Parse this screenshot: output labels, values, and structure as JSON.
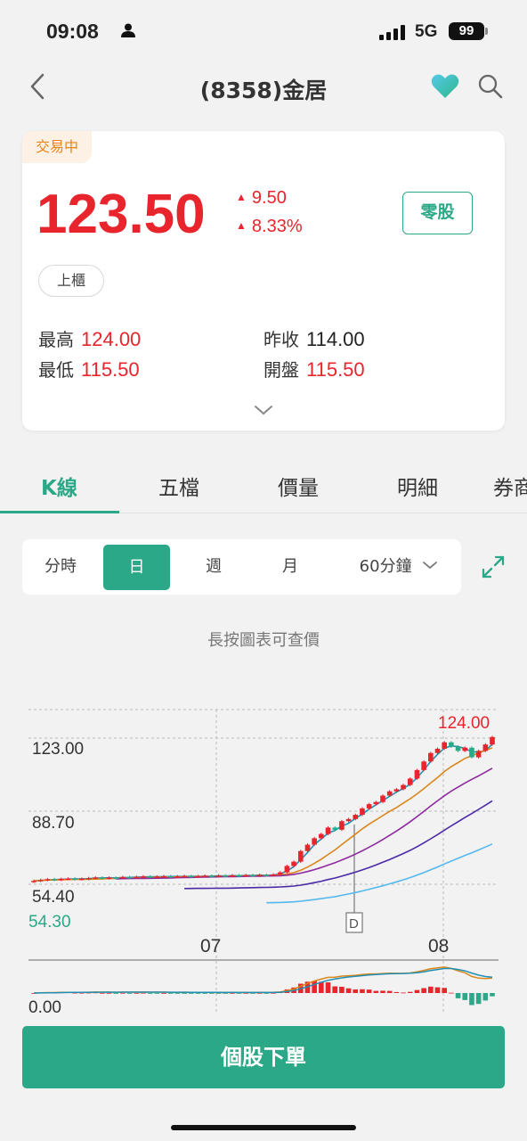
{
  "status_bar": {
    "time": "09:08",
    "network": "5G",
    "battery": "99"
  },
  "header": {
    "title": "(8358)金居"
  },
  "quote": {
    "status": "交易中",
    "price": "123.50",
    "change": "9.50",
    "change_pct": "8.33%",
    "odd_lot_label": "零股",
    "market": "上櫃",
    "high_label": "最高",
    "high": "124.00",
    "low_label": "最低",
    "low": "115.50",
    "prev_close_label": "昨收",
    "prev_close": "114.00",
    "open_label": "開盤",
    "open": "115.50"
  },
  "tabs": [
    "K線",
    "五檔",
    "價量",
    "明細",
    "券商"
  ],
  "periods": [
    "分時",
    "日",
    "週",
    "月",
    "60分鐘"
  ],
  "hint": "長按圖表可查價",
  "chart_data": {
    "type": "candlestick",
    "y_ticks": [
      "123.00",
      "88.70",
      "54.40"
    ],
    "y_low": "54.30",
    "max_label": "124.00",
    "x_ticks": [
      "07",
      "08"
    ],
    "marker": "D",
    "indicator_zero": "0.00",
    "closes": [
      56.0,
      56.4,
      56.8,
      56.5,
      56.9,
      57.1,
      56.8,
      57.0,
      57.3,
      57.6,
      57.2,
      57.5,
      57.4,
      57.8,
      57.6,
      57.9,
      58.1,
      57.8,
      58.0,
      58.2,
      57.9,
      58.1,
      58.3,
      58.0,
      58.2,
      58.4,
      58.1,
      58.5,
      58.3,
      58.6,
      58.4,
      58.7,
      58.5,
      58.8,
      58.6,
      59.0,
      60.0,
      63.0,
      65.0,
      70.0,
      73.0,
      76.0,
      78.0,
      81.0,
      80.0,
      84.0,
      85.0,
      87.0,
      90.0,
      92.0,
      93.0,
      96.0,
      98.0,
      99.0,
      101.0,
      104.0,
      108.0,
      112.0,
      116.0,
      118.0,
      121.0,
      119.0,
      117.0,
      118.5,
      114.0,
      117.0,
      120.0,
      123.5
    ]
  },
  "bottom": {
    "order_label": "個股下單"
  },
  "colors": {
    "up": "#e8242c",
    "down": "#2aa887",
    "accent": "#2aa887"
  }
}
